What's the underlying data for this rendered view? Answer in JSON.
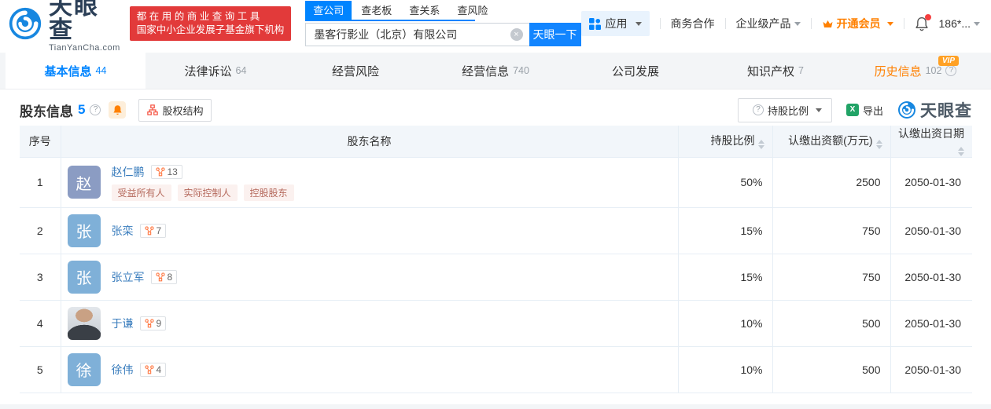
{
  "brand": {
    "name_cn": "天眼查",
    "name_en": "TianYanCha.com",
    "blue": "#0084ff",
    "orange": "#ff8000"
  },
  "promo": {
    "line1": "都在用的商业查询工具",
    "line2": "国家中小企业发展子基金旗下机构"
  },
  "search": {
    "tabs": [
      {
        "label": "查公司",
        "active": true
      },
      {
        "label": "查老板",
        "active": false
      },
      {
        "label": "查关系",
        "active": false
      },
      {
        "label": "查风险",
        "active": false
      }
    ],
    "value": "墨客行影业（北京）有限公司",
    "button_label": "天眼一下"
  },
  "top_nav": {
    "apps": "应用",
    "business": "商务合作",
    "enterprise": "企业级产品",
    "vip": "开通会员",
    "phone": "186*..."
  },
  "main_tabs": [
    {
      "label": "基本信息",
      "count": "44",
      "active": true,
      "vip": false,
      "help": false
    },
    {
      "label": "法律诉讼",
      "count": "64",
      "active": false,
      "vip": false,
      "help": false
    },
    {
      "label": "经营风险",
      "count": "",
      "active": false,
      "vip": false,
      "help": false
    },
    {
      "label": "经营信息",
      "count": "740",
      "active": false,
      "vip": false,
      "help": false
    },
    {
      "label": "公司发展",
      "count": "",
      "active": false,
      "vip": false,
      "help": false
    },
    {
      "label": "知识产权",
      "count": "7",
      "active": false,
      "vip": false,
      "help": false
    },
    {
      "label": "历史信息",
      "count": "102",
      "active": false,
      "vip": true,
      "help": true
    }
  ],
  "vip_badge": "VIP",
  "section": {
    "title": "股东信息",
    "count": "5",
    "structure_button": "股权结构",
    "ratio_button": "持股比例",
    "export_button": "导出",
    "watermark": "天眼查"
  },
  "icons": {
    "help": "?",
    "clear": "×",
    "excel": "X"
  },
  "table": {
    "headers": [
      "序号",
      "股东名称",
      "持股比例",
      "认缴出资额(万元)",
      "认缴出资日期"
    ],
    "rows": [
      {
        "no": "1",
        "name": "赵仁鹏",
        "avatar": "赵",
        "avatar_color": "#8b9cc3",
        "photo": false,
        "relation_count": "13",
        "tags": [
          "受益所有人",
          "实际控制人",
          "控股股东"
        ],
        "ratio": "50%",
        "amount": "2500",
        "date": "2050-01-30"
      },
      {
        "no": "2",
        "name": "张栾",
        "avatar": "张",
        "avatar_color": "#7fb0d8",
        "photo": false,
        "relation_count": "7",
        "tags": [],
        "ratio": "15%",
        "amount": "750",
        "date": "2050-01-30"
      },
      {
        "no": "3",
        "name": "张立军",
        "avatar": "张",
        "avatar_color": "#7fb0d8",
        "photo": false,
        "relation_count": "8",
        "tags": [],
        "ratio": "15%",
        "amount": "750",
        "date": "2050-01-30"
      },
      {
        "no": "4",
        "name": "于谦",
        "avatar": "",
        "avatar_color": "",
        "photo": true,
        "relation_count": "9",
        "tags": [],
        "ratio": "10%",
        "amount": "500",
        "date": "2050-01-30"
      },
      {
        "no": "5",
        "name": "徐伟",
        "avatar": "徐",
        "avatar_color": "#7fb0d8",
        "photo": false,
        "relation_count": "4",
        "tags": [],
        "ratio": "10%",
        "amount": "500",
        "date": "2050-01-30"
      }
    ]
  }
}
